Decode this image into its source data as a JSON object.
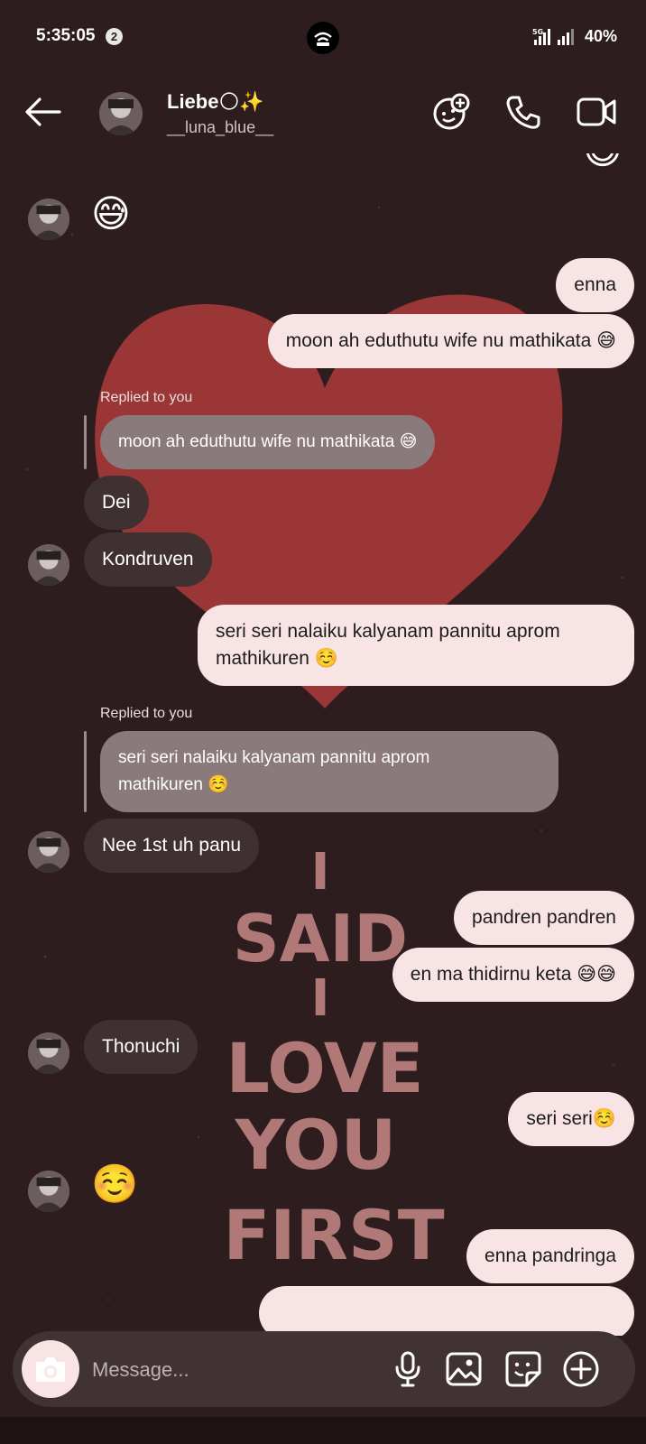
{
  "status": {
    "time": "5:35:05",
    "notification_count": "2",
    "network": "5G",
    "battery": "40%"
  },
  "header": {
    "name": "Liebe🌕✨",
    "username": "__luna_blue__",
    "icons": [
      "back-arrow-icon",
      "add-effects-icon",
      "phone-icon",
      "video-camera-icon"
    ]
  },
  "background": {
    "theme": "heart",
    "art_lines": [
      "I",
      "SAID",
      "I",
      "LOVE",
      "YOU",
      "FIRST"
    ],
    "colors": {
      "base": "#2e1d1f",
      "heart": "#9b3636",
      "art_text": "#c78a87"
    }
  },
  "messages": [
    {
      "id": "m1",
      "from": "them",
      "text": "😅",
      "emoji_only": true
    },
    {
      "id": "m2",
      "from": "me",
      "text": "enna"
    },
    {
      "id": "m3",
      "from": "me",
      "text": "moon ah eduthutu wife nu mathikata 😅"
    },
    {
      "id": "m4",
      "from": "them",
      "reply_label": "Replied to you",
      "quoted": "moon ah eduthutu wife nu mathikata 😅",
      "text": "Dei"
    },
    {
      "id": "m5",
      "from": "them",
      "text": "Kondruven"
    },
    {
      "id": "m6",
      "from": "me",
      "line1": "seri seri nalaiku kalyanam pannitu aprom",
      "line2": "mathikuren ☺️"
    },
    {
      "id": "m7",
      "from": "them",
      "reply_label": "Replied to you",
      "quoted_line1": "seri seri nalaiku kalyanam pannitu aprom",
      "quoted_line2": "mathikuren ☺️",
      "text": "Nee 1st uh panu"
    },
    {
      "id": "m8",
      "from": "me",
      "text": "pandren pandren"
    },
    {
      "id": "m9",
      "from": "me",
      "text": "en ma thidirnu keta 😅😅"
    },
    {
      "id": "m10",
      "from": "them",
      "text": "Thonuchi"
    },
    {
      "id": "m11",
      "from": "me",
      "text": "seri seri☺️"
    },
    {
      "id": "m12",
      "from": "them",
      "text": "☺️",
      "emoji_only": true
    },
    {
      "id": "m13",
      "from": "me",
      "text": "enna pandringa"
    }
  ],
  "composer": {
    "placeholder": "Message...",
    "icons": [
      "camera-icon",
      "microphone-icon",
      "gallery-icon",
      "sticker-icon",
      "add-icon"
    ]
  },
  "colors": {
    "outgoing_bubble": "#f8e4e4",
    "incoming_bubble": "#3f3031",
    "quoted_bubble": "#8b7a7b"
  }
}
